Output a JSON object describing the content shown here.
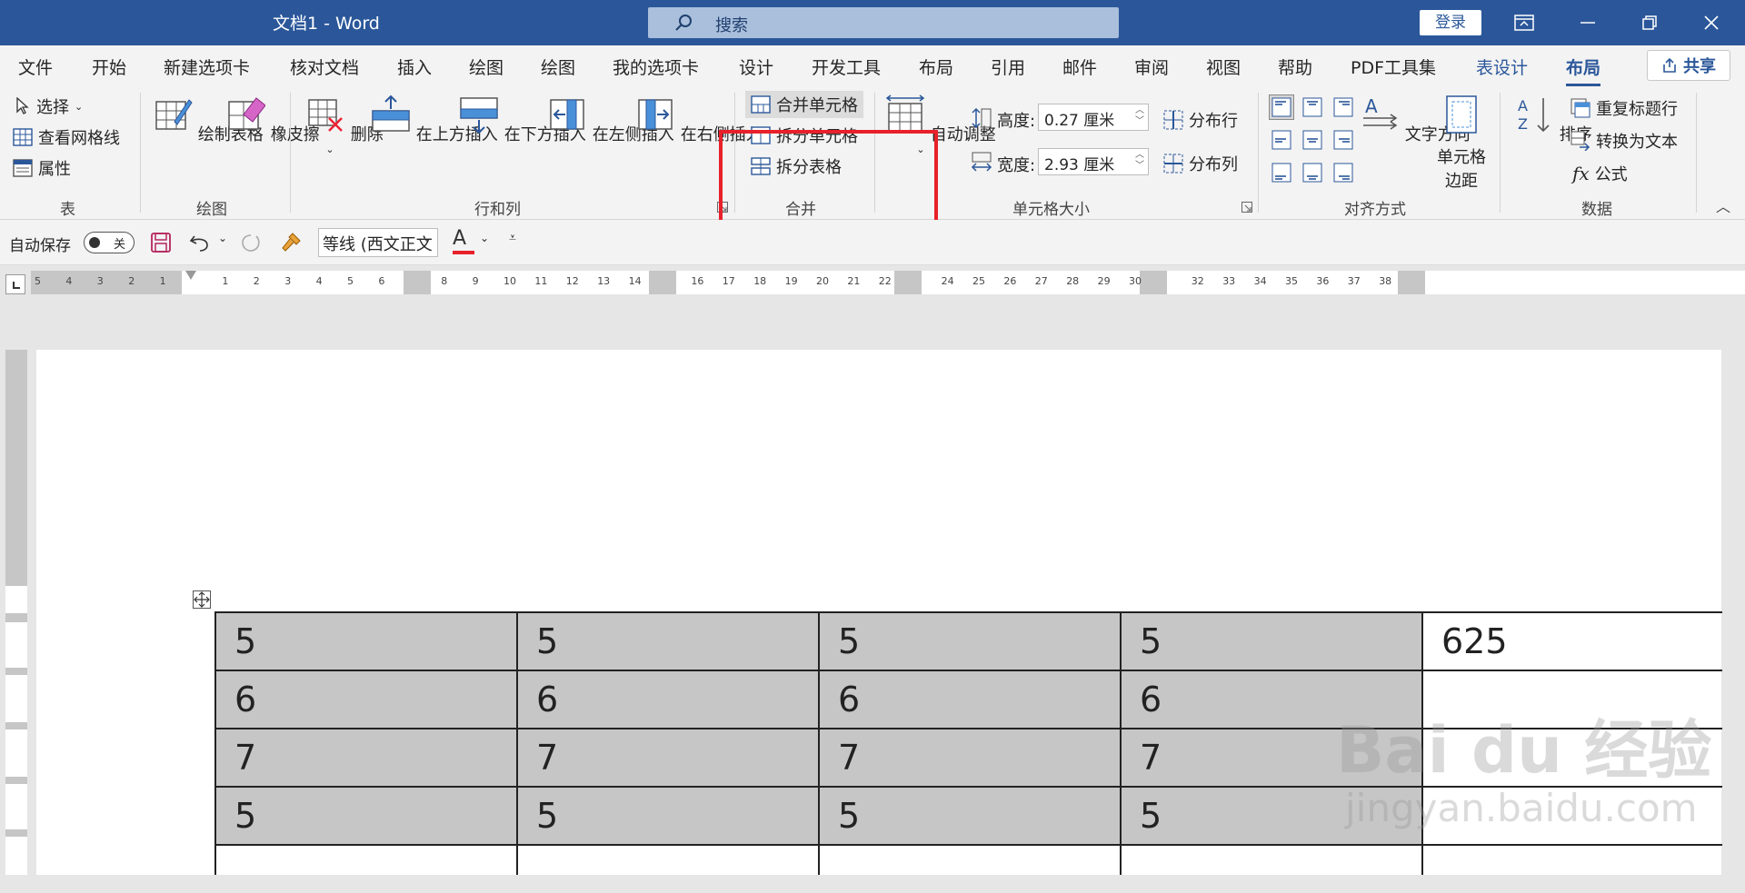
{
  "titlebar": {
    "doc_title": "文档1  -  Word",
    "search_placeholder": "搜索",
    "login_label": "登录"
  },
  "tabs": [
    "文件",
    "开始",
    "新建选项卡",
    "核对文档",
    "插入",
    "绘图",
    "绘图",
    "我的选项卡",
    "设计",
    "开发工具",
    "布局",
    "引用",
    "邮件",
    "审阅",
    "视图",
    "帮助",
    "PDF工具集",
    "表设计",
    "布局"
  ],
  "share_label": "共享",
  "ribbon": {
    "table_group": {
      "select": "选择",
      "gridlines": "查看网格线",
      "properties": "属性",
      "label": "表"
    },
    "draw_group": {
      "draw_table": "绘制表格",
      "eraser": "橡皮擦",
      "label": "绘图"
    },
    "rowcol_group": {
      "delete": "删除",
      "insert_above": "在上方插入",
      "insert_below": "在下方插入",
      "insert_left": "在左侧插入",
      "insert_right": "在右侧插入",
      "label": "行和列"
    },
    "merge_group": {
      "merge_cells": "合并单元格",
      "split_cells": "拆分单元格",
      "split_table": "拆分表格",
      "label": "合并"
    },
    "cellsize_group": {
      "autofit": "自动调整",
      "height_label": "高度:",
      "height_value": "0.27 厘米",
      "width_label": "宽度:",
      "width_value": "2.93 厘米",
      "dist_rows": "分布行",
      "dist_cols": "分布列",
      "label": "单元格大小"
    },
    "align_group": {
      "text_dir": "文字方向",
      "cell_margins_1": "单元格",
      "cell_margins_2": "边距",
      "label": "对齐方式"
    },
    "data_group": {
      "sort": "排序",
      "repeat_header": "重复标题行",
      "convert_text": "转换为文本",
      "formula": "公式",
      "label": "数据"
    }
  },
  "qat": {
    "autosave_label": "自动保存",
    "autosave_state": "关",
    "font_name": "等线 (西文正文"
  },
  "ruler": {
    "left_numbers": [
      "5",
      "4",
      "3",
      "2",
      "1"
    ],
    "right_numbers": [
      "1",
      "2",
      "3",
      "4",
      "5",
      "6",
      "8",
      "9",
      "10",
      "11",
      "12",
      "13",
      "14",
      "16",
      "17",
      "18",
      "19",
      "20",
      "21",
      "22",
      "24",
      "25",
      "26",
      "27",
      "28",
      "29",
      "30",
      "32",
      "33",
      "34",
      "35",
      "36",
      "37",
      "38"
    ]
  },
  "table": {
    "rows": [
      [
        "5",
        "5",
        "5",
        "5",
        "625"
      ],
      [
        "6",
        "6",
        "6",
        "6",
        ""
      ],
      [
        "7",
        "7",
        "7",
        "7",
        ""
      ],
      [
        "5",
        "5",
        "5",
        "5",
        ""
      ],
      [
        "",
        "",
        "",
        "",
        ""
      ]
    ]
  },
  "watermark": {
    "main": "Bai du 经验",
    "sub": "jingyan.baidu.com"
  },
  "colors": {
    "accent": "#2b579a",
    "highlight": "#e8202a",
    "selection": "#c6c6c6"
  }
}
